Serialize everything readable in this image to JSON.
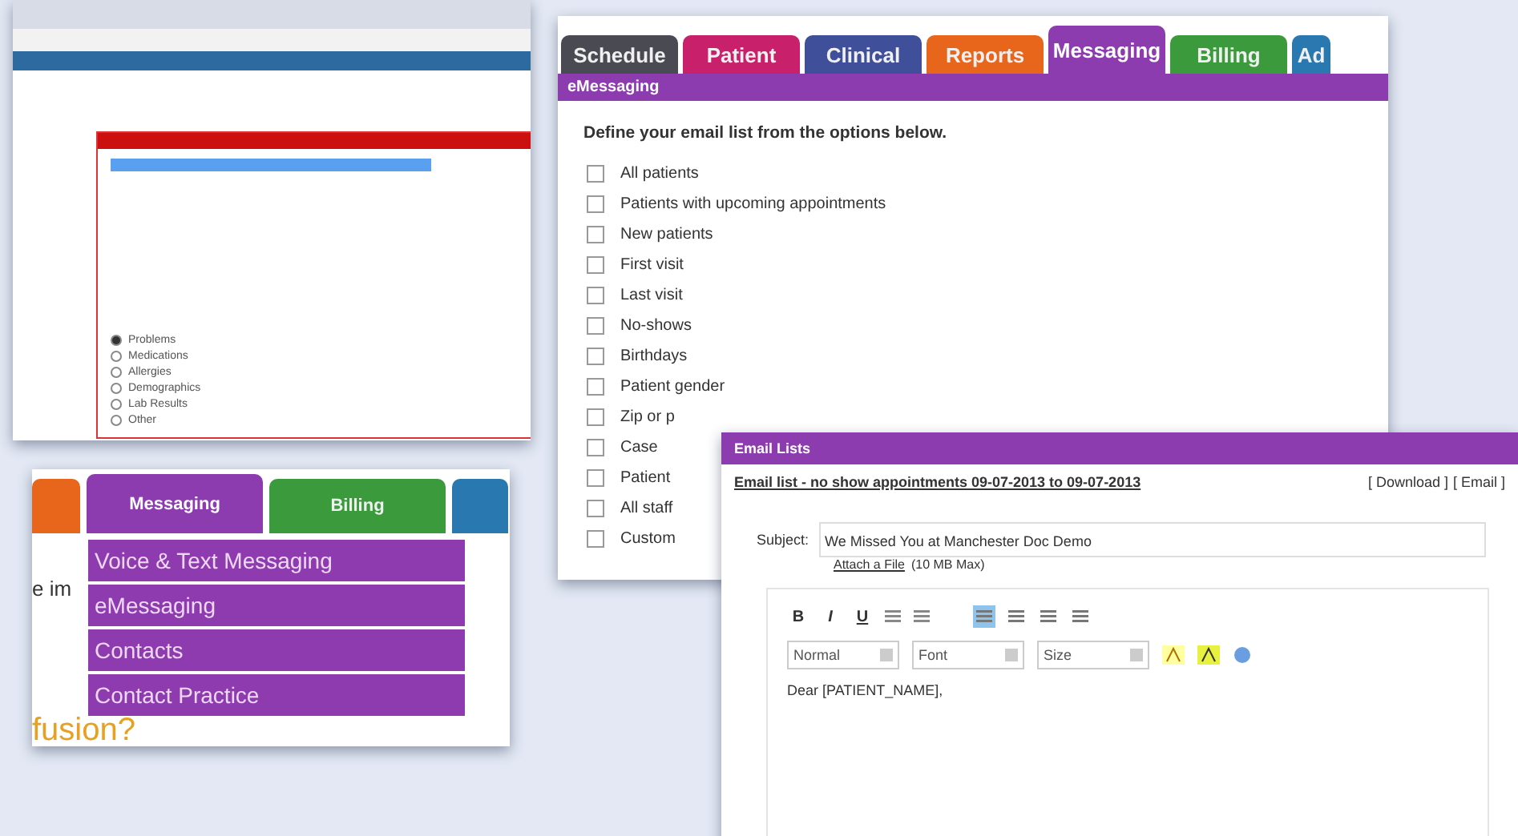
{
  "record_window": {
    "options": [
      {
        "label": "Problems",
        "selected": true
      },
      {
        "label": "Medications",
        "selected": false
      },
      {
        "label": "Allergies",
        "selected": false
      },
      {
        "label": "Demographics",
        "selected": false
      },
      {
        "label": "Lab Results",
        "selected": false
      },
      {
        "label": "Other",
        "selected": false
      }
    ]
  },
  "messaging_window": {
    "tabs": [
      {
        "label": "Schedule",
        "color": "#4a4a52",
        "selected": false
      },
      {
        "label": "Patient",
        "color": "#c8206a",
        "selected": false
      },
      {
        "label": "Clinical",
        "color": "#3f4f99",
        "selected": false
      },
      {
        "label": "Reports",
        "color": "#e8661c",
        "selected": false
      },
      {
        "label": "Messaging",
        "color": "#8c3cae",
        "selected": true
      },
      {
        "label": "Billing",
        "color": "#3a9a3c",
        "selected": false
      },
      {
        "label": "Ad",
        "color": "#2a78b0",
        "selected": false
      }
    ],
    "section_title": "eMessaging",
    "instruction": "Define your email list from the options below.",
    "options": [
      {
        "label": "All patients",
        "checked": false
      },
      {
        "label": "Patients with upcoming appointments",
        "checked": false
      },
      {
        "label": "New patients",
        "checked": false
      },
      {
        "label": "First visit",
        "checked": false
      },
      {
        "label": "Last visit",
        "checked": false
      },
      {
        "label": "No-shows",
        "checked": false
      },
      {
        "label": "Birthdays",
        "checked": false
      },
      {
        "label": "Patient gender",
        "checked": false
      },
      {
        "label": "Zip or p",
        "checked": false
      },
      {
        "label": "Case",
        "checked": false
      },
      {
        "label": "Patient",
        "checked": false
      },
      {
        "label": "All staff",
        "checked": false
      },
      {
        "label": "Custom",
        "checked": false
      }
    ]
  },
  "menu_window": {
    "tabs": [
      {
        "color": "#e8661c",
        "selected": false
      },
      {
        "label": "Messaging",
        "color": "#8c3cae",
        "selected": true
      },
      {
        "label": "Billing",
        "color": "#3a9a3c",
        "selected": false
      },
      {
        "color": "#2a78b0",
        "selected": false
      }
    ],
    "background_text": "e im",
    "heading_fragment": "fusion?",
    "menu_items": [
      "Voice & Text Messaging",
      "eMessaging",
      "Contacts",
      "Contact Practice"
    ]
  },
  "email_window": {
    "title": "Email Lists",
    "list_link": "Email list - no show appointments 09-07-2013 to 09-07-2013",
    "actions": [
      "[ Download ]",
      "[ Email ]"
    ],
    "subject_label": "Subject:",
    "subject": "We Missed You at Manchester Doc Demo",
    "attach_link": "Attach a File",
    "attach_note": "(10 MB Max)",
    "format_buttons": [
      "B",
      "I",
      "U"
    ],
    "alignments": [
      {
        "selected": true
      },
      {
        "selected": false
      },
      {
        "selected": false
      },
      {
        "selected": false
      }
    ],
    "dropdowns": [
      "Normal",
      "Font",
      "Size"
    ],
    "body": "Dear [PATIENT_NAME],"
  }
}
